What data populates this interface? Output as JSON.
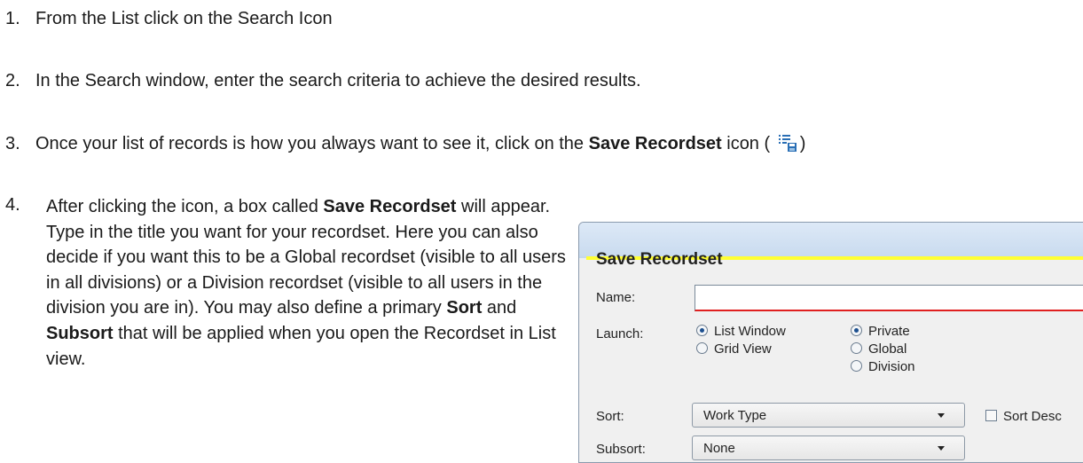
{
  "steps": [
    {
      "num": "1.",
      "text": "From the List click on the Search Icon"
    },
    {
      "num": "2.",
      "text": "In the Search window, enter the search criteria to achieve the desired results."
    },
    {
      "num": "3.",
      "text_before": "Once your list of records is how you always want to see it, click on the ",
      "bold": "Save Recordset",
      "text_after": " icon (",
      "close": ")",
      "icon": "save-recordset-icon"
    },
    {
      "num": "4.",
      "t1": "After clicking the icon, a box called ",
      "b1": "Save Recordset",
      "t2": " will appear. Type in the title you want for your recordset. Here you can also decide if you want this to be a Global recordset (visible to all users in all divisions) or a Division recordset (visible to all users in the division you are in). You may also define a primary ",
      "b2": "Sort",
      "t3": " and ",
      "b3": "Subsort",
      "t4": " that will be applied when you open the Recordset in List view."
    }
  ],
  "dialog": {
    "title": "Save Recordset",
    "name_label": "Name:",
    "name_value": "",
    "launch_label": "Launch:",
    "launch_options": [
      {
        "label": "List Window",
        "selected": true
      },
      {
        "label": "Grid View",
        "selected": false
      }
    ],
    "scope_options": [
      {
        "label": "Private",
        "selected": true
      },
      {
        "label": "Global",
        "selected": false
      },
      {
        "label": "Division",
        "selected": false
      }
    ],
    "sort_label": "Sort:",
    "sort_value": "Work Type",
    "sort_desc_label": "Sort Desc",
    "subsort_label": "Subsort:",
    "subsort_value": "None"
  },
  "colors": {
    "highlight": "#ffff33",
    "required_underline": "#e02020",
    "icon_blue": "#2a6fb5"
  }
}
